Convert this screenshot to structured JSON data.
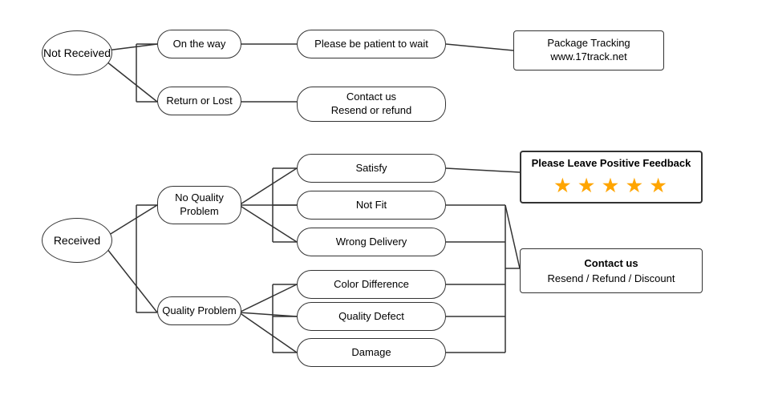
{
  "nodes": {
    "not_received": "Not\nReceived",
    "received": "Received",
    "on_the_way": "On the way",
    "return_or_lost": "Return or Lost",
    "patient": "Please be patient to wait",
    "contact_resend": "Contact us\nResend or refund",
    "package_tracking": "Package Tracking\nwww.17track.net",
    "no_quality": "No Quality\nProblem",
    "quality_problem": "Quality Problem",
    "satisfy": "Satisfy",
    "not_fit": "Not Fit",
    "wrong_delivery": "Wrong Delivery",
    "color_diff": "Color Difference",
    "quality_defect": "Quality Defect",
    "damage": "Damage",
    "positive_feedback_text": "Please Leave Positive Feedback",
    "stars": "★ ★ ★ ★ ★",
    "contact_us": "Contact us",
    "contact_options": "Resend / Refund / Discount"
  }
}
